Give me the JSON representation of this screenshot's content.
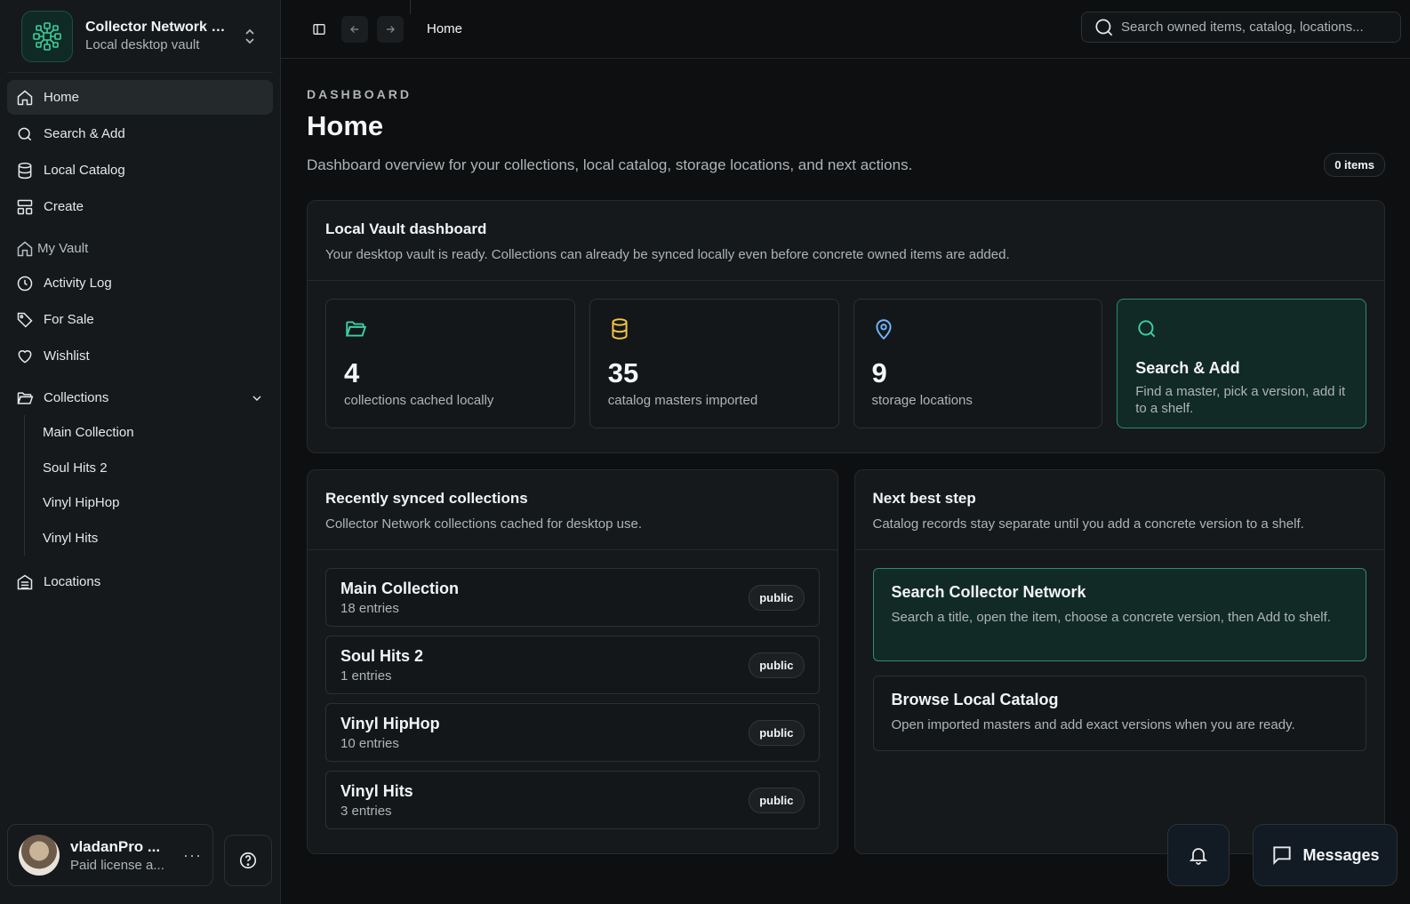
{
  "brand": {
    "title": "Collector Network V...",
    "subtitle": "Local desktop vault"
  },
  "nav": {
    "home": "Home",
    "search_add": "Search & Add",
    "local_catalog": "Local Catalog",
    "create": "Create",
    "my_vault": "My Vault",
    "activity_log": "Activity Log",
    "for_sale": "For Sale",
    "wishlist": "Wishlist",
    "collections": "Collections",
    "collection_items": [
      "Main Collection",
      "Soul Hits 2",
      "Vinyl HipHop",
      "Vinyl Hits"
    ],
    "locations": "Locations"
  },
  "user": {
    "name": "vladanPro ...",
    "subtitle": "Paid license a..."
  },
  "topbar": {
    "breadcrumb": "Home",
    "search_placeholder": "Search owned items, catalog, locations..."
  },
  "page": {
    "eyebrow": "DASHBOARD",
    "title": "Home",
    "description": "Dashboard overview for your collections, local catalog, storage locations, and next actions.",
    "items_badge": "0 items"
  },
  "dashboard": {
    "title": "Local Vault dashboard",
    "subtitle": "Your desktop vault is ready. Collections can already be synced locally even before concrete owned items are added.",
    "stats": [
      {
        "value": "4",
        "label": "collections cached locally",
        "icon": "folder-open-icon",
        "color": "#3ecf9f"
      },
      {
        "value": "35",
        "label": "catalog masters imported",
        "icon": "database-icon",
        "color": "#f5c542"
      },
      {
        "value": "9",
        "label": "storage locations",
        "icon": "map-pin-icon",
        "color": "#6fb6ff"
      }
    ],
    "action": {
      "title": "Search & Add",
      "description": "Find a master, pick a version, add it to a shelf.",
      "icon": "search-icon",
      "color": "#3ecf9f"
    }
  },
  "recent": {
    "title": "Recently synced collections",
    "subtitle": "Collector Network collections cached for desktop use.",
    "items": [
      {
        "name": "Main Collection",
        "count": "18 entries",
        "visibility": "public"
      },
      {
        "name": "Soul Hits 2",
        "count": "1 entries",
        "visibility": "public"
      },
      {
        "name": "Vinyl HipHop",
        "count": "10 entries",
        "visibility": "public"
      },
      {
        "name": "Vinyl Hits",
        "count": "3 entries",
        "visibility": "public"
      }
    ]
  },
  "next_step": {
    "title": "Next best step",
    "subtitle": "Catalog records stay separate until you add a concrete version to a shelf.",
    "options": [
      {
        "title": "Search Collector Network",
        "description": "Search a title, open the item, choose a concrete version, then Add to shelf."
      },
      {
        "title": "Browse Local Catalog",
        "description": "Open imported masters and add exact versions when you are ready."
      }
    ]
  },
  "floating": {
    "messages_label": "Messages"
  },
  "colors": {
    "accent": "#3ecf9f",
    "accent_bg": "#112a25",
    "background": "#0d0f10",
    "panel": "#15191b"
  }
}
